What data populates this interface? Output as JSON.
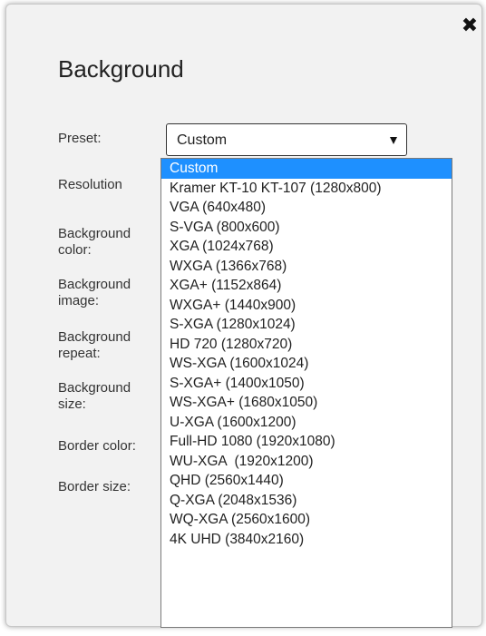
{
  "dialog": {
    "title": "Background",
    "close_icon": "close-icon"
  },
  "form": {
    "labels": {
      "preset": "Preset:",
      "resolution": "Resolution",
      "background_color": "Background color:",
      "background_image": "Background image:",
      "background_repeat": "Background repeat:",
      "background_size": "Background size:",
      "border_color": "Border color:",
      "border_size": "Border size:"
    },
    "preset_value": "Custom",
    "preset_options": [
      "Custom",
      "Kramer KT-10 KT-107 (1280x800)",
      "VGA (640x480)",
      "S-VGA (800x600)",
      "XGA (1024x768)",
      "WXGA (1366x768)",
      "XGA+ (1152x864)",
      "WXGA+ (1440x900)",
      "S-XGA (1280x1024)",
      "HD 720 (1280x720)",
      "WS-XGA (1600x1024)",
      "S-XGA+ (1400x1050)",
      "WS-XGA+ (1680x1050)",
      "U-XGA (1600x1200)",
      "Full-HD 1080 (1920x1080)",
      "WU-XGA  (1920x1200)",
      "QHD (2560x1440)",
      "Q-XGA (2048x1536)",
      "WQ-XGA (2560x1600)",
      "4K UHD (3840x2160)"
    ],
    "selected_index": 0
  },
  "colors": {
    "highlight": "#1e90ff",
    "dialog_bg": "#f2f2f2"
  }
}
